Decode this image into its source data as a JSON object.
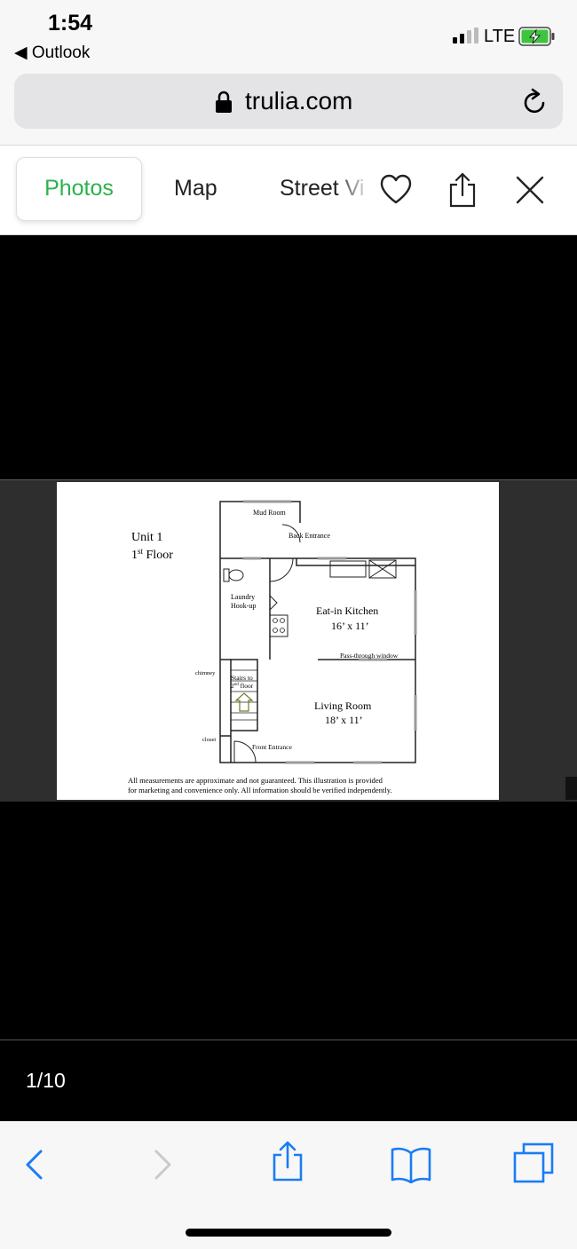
{
  "status": {
    "time": "1:54",
    "back_app": "◀ Outlook",
    "network": "LTE"
  },
  "browser": {
    "url": "trulia.com"
  },
  "tabs": [
    {
      "label": "Photos"
    },
    {
      "label": "Map"
    },
    {
      "label": "Street View"
    }
  ],
  "viewer": {
    "counter": "1/10"
  },
  "floorplan": {
    "unit_title": "Unit 1",
    "floor_num": "1",
    "floor_sup": "st",
    "floor_word": " Floor",
    "mud_room": "Mud Room",
    "back_entrance": "Back Entrance",
    "laundry_1": "Laundry",
    "laundry_2": "Hook-up",
    "kitchen_name": "Eat-in Kitchen",
    "kitchen_size": "16’ x 11’",
    "pass_through": "Pass-through window",
    "chimney": "chimney",
    "stairs_1": "Stairs to",
    "stairs_2_num": "2",
    "stairs_2_sup": "nd",
    "stairs_2_word": " floor",
    "living_name": "Living Room",
    "living_size": "18’ x 11’",
    "closet": "closet",
    "front_entrance": "Front Entrance",
    "disclaimer_1": "All measurements are approximate and not guaranteed. This illustration is provided",
    "disclaimer_2": "for marketing and convenience only. All information should be verified independently."
  },
  "colors": {
    "accent": "#2bb24c",
    "ios_blue": "#1a7cf5"
  }
}
